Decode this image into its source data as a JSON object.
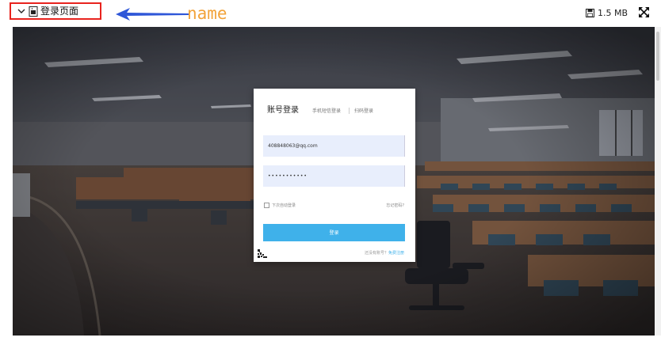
{
  "header": {
    "title": "登录页面",
    "annotation_label": "name",
    "file_size": "1.5 MB",
    "icons": {
      "collapse": "chevron-down-icon",
      "file": "image-file-icon",
      "save": "save-icon",
      "expand": "expand-icon"
    }
  },
  "login_card": {
    "tab_account": "账号登录",
    "tab_sms": "手机短信登录",
    "tab_qr": "扫码登录",
    "username_value": "408848063@qq.com",
    "password_value": "•••••••••••",
    "remember_label": "下次自动登录",
    "forgot_label": "忘记密码?",
    "submit_label": "登录",
    "signup_prompt": "还没有账号？",
    "signup_link": "免费注册"
  },
  "colors": {
    "highlight_box": "#e8231e",
    "annotation_arrow": "#2f57d8",
    "annotation_text": "#f2a33a",
    "login_button": "#3fb1ea",
    "input_background": "#e8eefc"
  }
}
